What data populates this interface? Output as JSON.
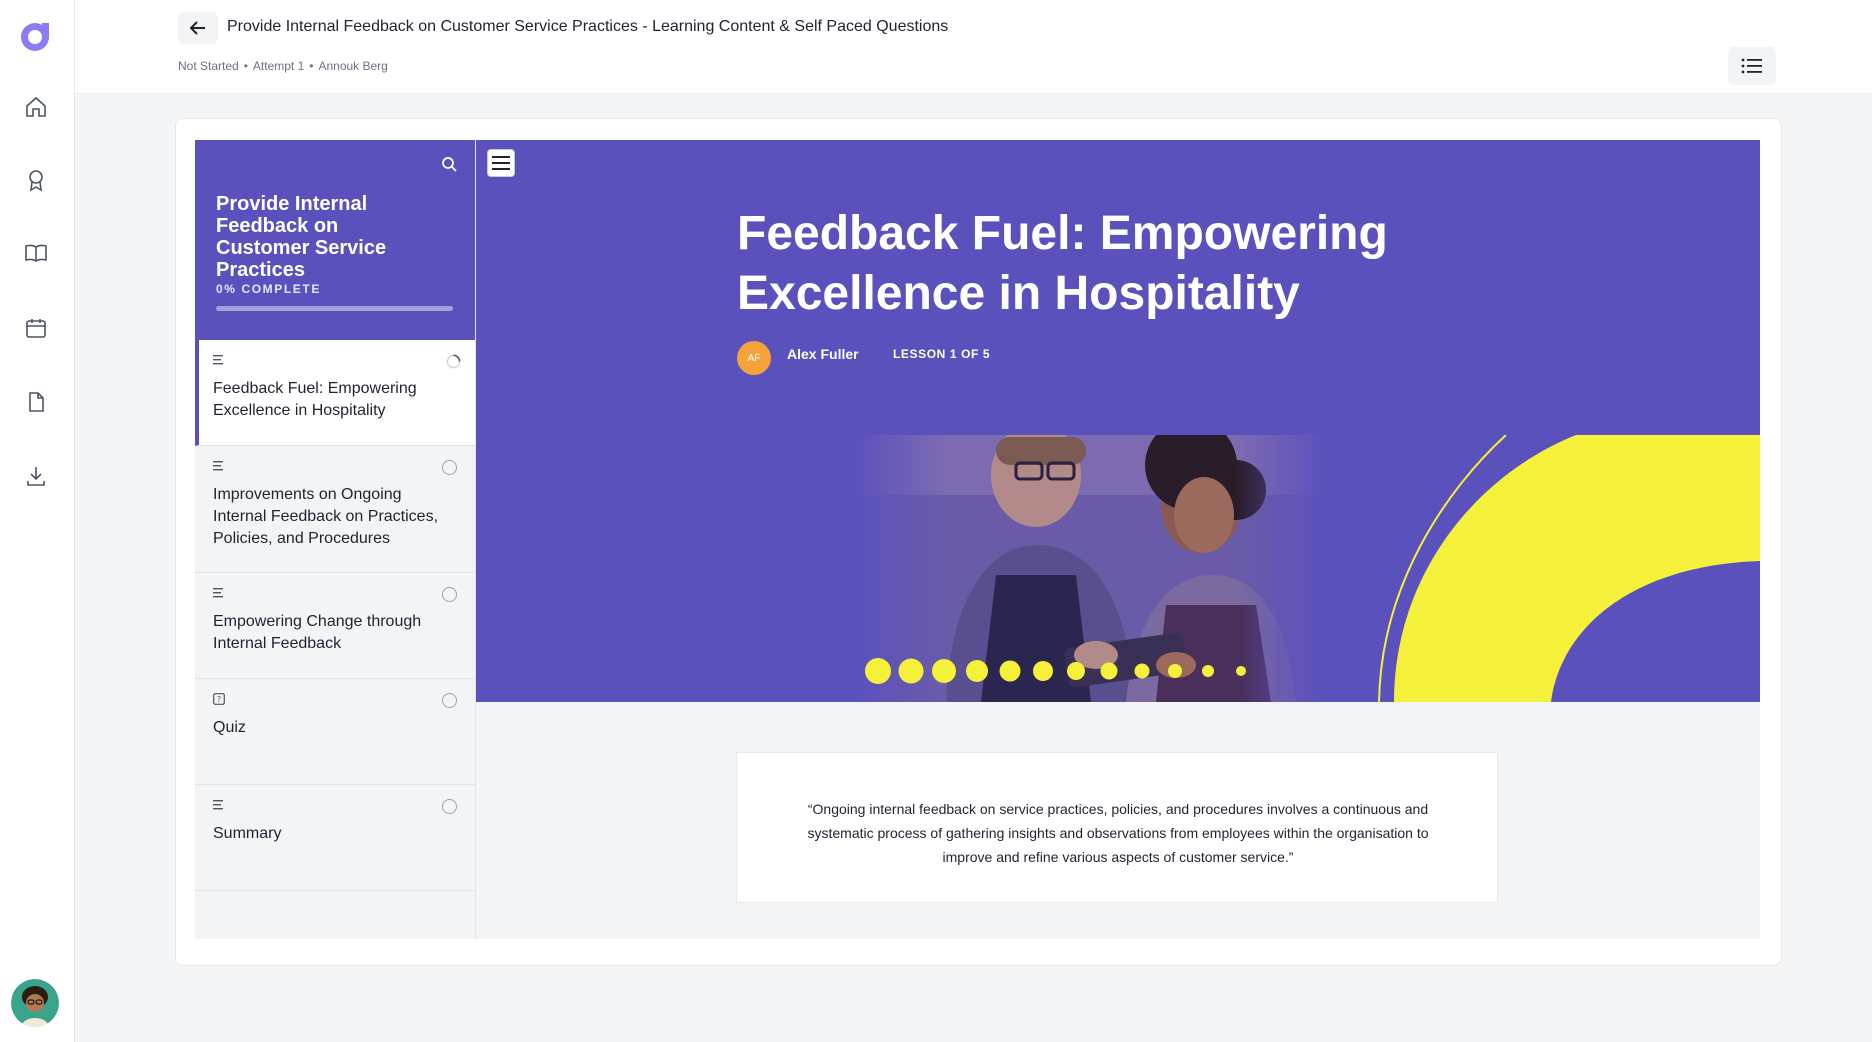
{
  "header": {
    "title": "Provide Internal Feedback on Customer Service Practices - Learning Content & Self Paced Questions",
    "meta": [
      "Not Started",
      "Attempt 1",
      "Annouk Berg"
    ]
  },
  "rail": {
    "icons": [
      "home-icon",
      "award-icon",
      "book-icon",
      "calendar-icon",
      "document-icon",
      "download-icon"
    ]
  },
  "course": {
    "title": "Provide Internal Feedback on Customer Service Practices",
    "progress_label": "0% COMPLETE",
    "progress": 0,
    "lessons": [
      {
        "title": "Feedback Fuel: Empowering Excellence in Hospitality",
        "type": "text",
        "status": "in-progress"
      },
      {
        "title": "Improvements on Ongoing Internal Feedback on Practices, Policies, and Procedures",
        "type": "text",
        "status": "not-started"
      },
      {
        "title": "Empowering Change through Internal Feedback",
        "type": "text",
        "status": "not-started"
      },
      {
        "title": "Quiz",
        "type": "quiz",
        "status": "not-started"
      },
      {
        "title": "Summary",
        "type": "text",
        "status": "not-started"
      }
    ]
  },
  "lesson": {
    "heading": "Feedback Fuel: Empowering Excellence in Hospitality",
    "author_initials": "AF",
    "author_name": "Alex Fuller",
    "lesson_count": "LESSON 1 OF 5",
    "quote": "“Ongoing internal feedback on service practices, policies, and procedures involves a continuous and systematic process of gathering insights and observations from employees within the organisation to improve and refine various aspects of customer service.”"
  },
  "colors": {
    "accent": "#5b51bd",
    "highlight": "#f5f03a",
    "avatar": "#f4a33a"
  }
}
